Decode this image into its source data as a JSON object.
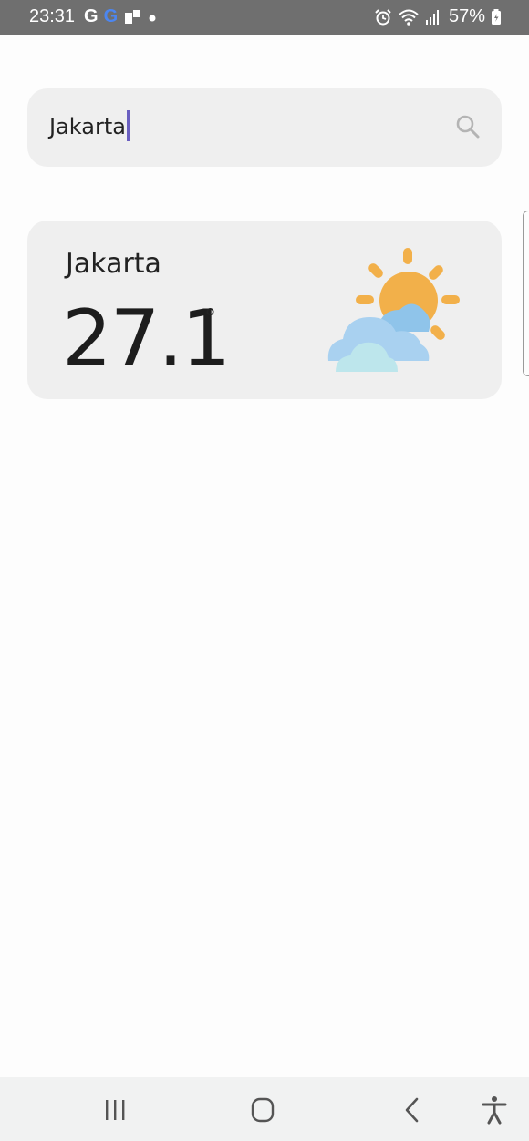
{
  "status_bar": {
    "time": "23:31",
    "battery": "57%",
    "left_icons": [
      "g-icon",
      "google-icon",
      "notification-icon",
      "dot-icon"
    ],
    "right_icons": [
      "alarm-icon",
      "wifi-icon",
      "signal-icon",
      "battery-icon"
    ]
  },
  "search": {
    "value": "Jakarta",
    "icon": "search-icon"
  },
  "weather": {
    "city": "Jakarta",
    "temperature": "27.1",
    "unit_symbol": "°",
    "condition_icon": "partly-cloudy-icon",
    "colors": {
      "sun": "#F2B04A",
      "cloud_back": "#8FC4EA",
      "cloud_mid": "#A9D1F0",
      "cloud_front": "#BDE6EC"
    }
  },
  "nav_bar": {
    "buttons": [
      "recent-apps-icon",
      "home-icon",
      "back-icon",
      "accessibility-icon"
    ]
  }
}
